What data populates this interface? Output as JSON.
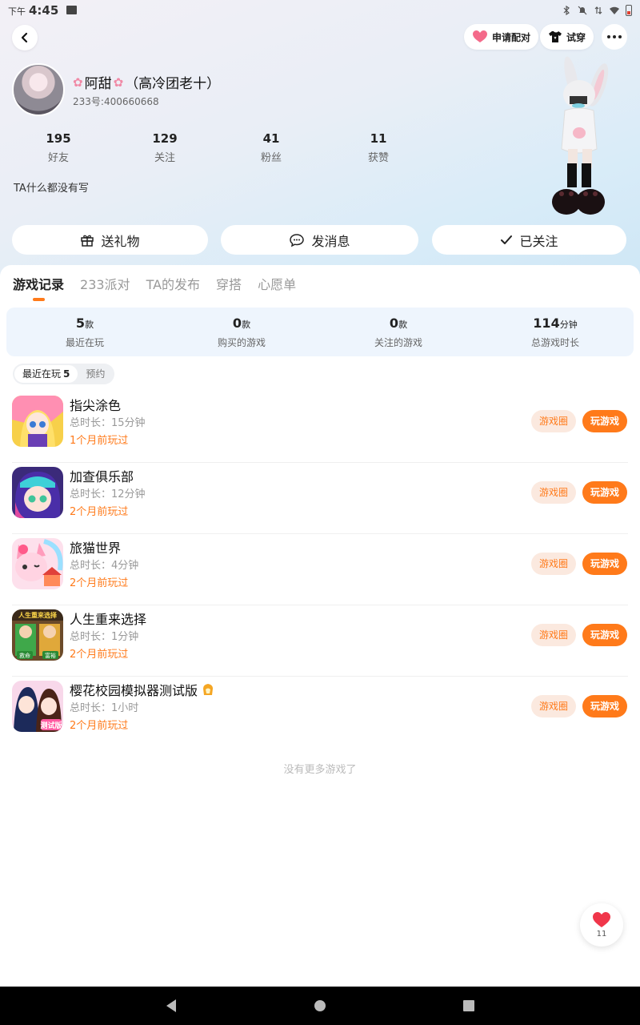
{
  "status_bar": {
    "ampm": "下午",
    "time": "4:45"
  },
  "header": {
    "match_label": "申请配对",
    "try_on_label": "试穿"
  },
  "profile": {
    "name": "阿甜",
    "name_suffix": "（高冷团老十）",
    "uid": "233号:400660668",
    "bio": "TA什么都没有写",
    "stats": [
      {
        "value": "195",
        "label": "好友"
      },
      {
        "value": "129",
        "label": "关注"
      },
      {
        "value": "41",
        "label": "粉丝"
      },
      {
        "value": "11",
        "label": "获赞"
      }
    ]
  },
  "actions": {
    "gift": "送礼物",
    "message": "发消息",
    "followed": "已关注"
  },
  "tabs": [
    "游戏记录",
    "233派对",
    "TA的发布",
    "穿搭",
    "心愿单"
  ],
  "summary": [
    {
      "value": "5",
      "unit": "款",
      "label": "最近在玩"
    },
    {
      "value": "0",
      "unit": "款",
      "label": "购买的游戏"
    },
    {
      "value": "0",
      "unit": "款",
      "label": "关注的游戏"
    },
    {
      "value": "114",
      "unit": "分钟",
      "label": "总游戏时长"
    }
  ],
  "filter": {
    "recent": "最近在玩",
    "recent_count": "5",
    "reserve": "预约"
  },
  "games": [
    {
      "title": "指尖涂色",
      "time": "总时长：15分钟",
      "last": "1个月前玩过"
    },
    {
      "title": "加查俱乐部",
      "time": "总时长：12分钟",
      "last": "2个月前玩过"
    },
    {
      "title": "旅猫世界",
      "time": "总时长：4分钟",
      "last": "2个月前玩过"
    },
    {
      "title": "人生重来选择",
      "time": "总时长：1分钟",
      "last": "2个月前玩过"
    },
    {
      "title": "樱花校园模拟器测试版",
      "time": "总时长：1小时",
      "last": "2个月前玩过"
    }
  ],
  "game_buttons": {
    "circle": "游戏圈",
    "play": "玩游戏"
  },
  "icon_texts": {
    "game4_banner": "人生重来选择",
    "game4_left": "救命",
    "game4_right": "富裕",
    "game5_badge": "测试版"
  },
  "no_more": "没有更多游戏了",
  "like_count": "11",
  "colors": {
    "accent": "#ff7a1a",
    "accent_soft": "#fbe9df",
    "summary_bg": "#eef5fd"
  }
}
